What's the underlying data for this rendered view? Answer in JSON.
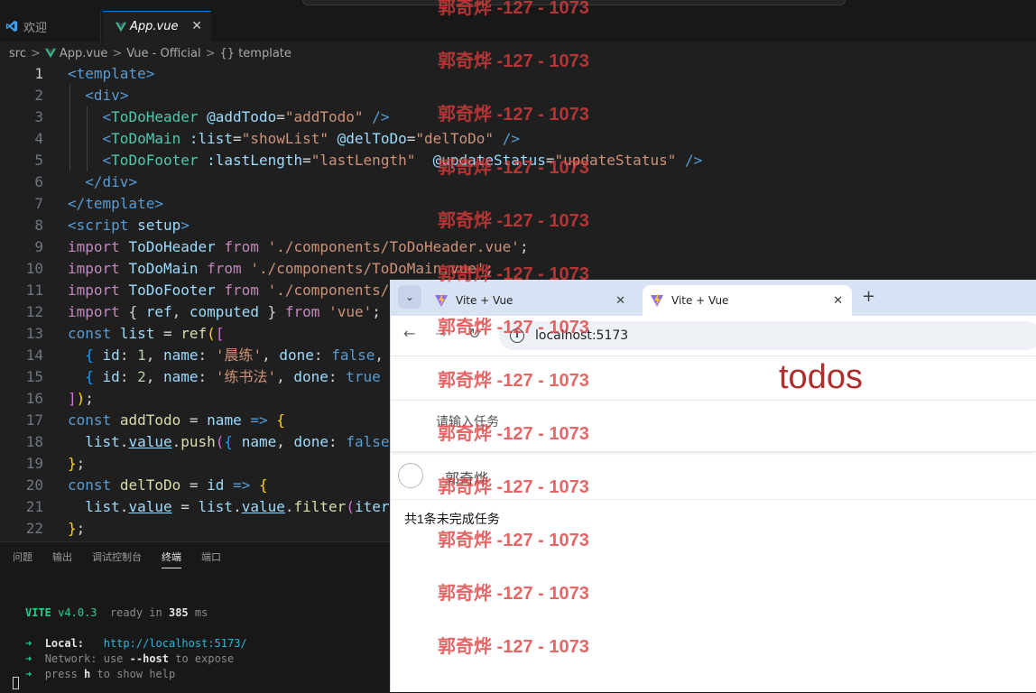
{
  "vscode": {
    "tabs": [
      {
        "label": "欢迎",
        "icon": "vscode-logo-icon"
      },
      {
        "label": "App.vue",
        "icon": "vue-file-icon"
      }
    ],
    "breadcrumb": {
      "src": "src",
      "file": "App.vue",
      "lang": "Vue - Official",
      "symbol": "{} template"
    },
    "code_lines": [
      {
        "n": "1"
      },
      {
        "n": "2"
      },
      {
        "n": "3"
      },
      {
        "n": "4"
      },
      {
        "n": "5"
      },
      {
        "n": "6"
      },
      {
        "n": "7"
      },
      {
        "n": "8"
      },
      {
        "n": "9"
      },
      {
        "n": "10"
      },
      {
        "n": "11"
      },
      {
        "n": "12"
      },
      {
        "n": "13"
      },
      {
        "n": "14"
      },
      {
        "n": "15"
      },
      {
        "n": "16"
      },
      {
        "n": "17"
      },
      {
        "n": "18"
      },
      {
        "n": "19"
      },
      {
        "n": "20"
      },
      {
        "n": "21"
      },
      {
        "n": "22"
      }
    ],
    "code": {
      "l1": [
        "<",
        "template",
        ">"
      ],
      "l2": [
        "<",
        "div",
        ">"
      ],
      "l3": [
        "<",
        "ToDoHeader",
        "@addTodo",
        "=",
        "\"addTodo\"",
        "/>"
      ],
      "l4": [
        "<",
        "ToDoMain",
        ":list",
        "=",
        "\"showList\"",
        "@delToDo",
        "=",
        "\"delToDo\"",
        "/>"
      ],
      "l5": [
        "<",
        "ToDoFooter",
        ":lastLength",
        "=",
        "\"lastLength\"",
        "@updateStatus",
        "=",
        "\"updateStatus\"",
        "/>"
      ],
      "l6": [
        "</",
        "div",
        ">"
      ],
      "l7": [
        "</",
        "template",
        ">"
      ],
      "l8": [
        "<",
        "script",
        "setup",
        ">"
      ],
      "l9": [
        "import",
        "ToDoHeader",
        "from",
        "'./components/ToDoHeader.vue'",
        ";"
      ],
      "l10": [
        "import",
        "ToDoMain",
        "from",
        "'./components/ToDoMain.vue'",
        ";"
      ],
      "l11": [
        "import",
        "ToDoFooter",
        "from",
        "'./components/"
      ],
      "l12": [
        "import",
        "{",
        "ref",
        ",",
        "computed",
        "}",
        "from",
        "'vue'",
        ";"
      ],
      "l13": [
        "const",
        "list",
        "=",
        "ref",
        "(",
        "["
      ],
      "l14": [
        "{",
        "id",
        ":",
        "1",
        ",",
        "name",
        ":",
        "'晨练'",
        ",",
        "done",
        ":",
        "false",
        ","
      ],
      "l15": [
        "{",
        "id",
        ":",
        "2",
        ",",
        "name",
        ":",
        "'练书法'",
        ",",
        "done",
        ":",
        "true"
      ],
      "l16": [
        "]",
        ")",
        ";"
      ],
      "l17": [
        "const",
        "addTodo",
        "=",
        "name",
        "=>",
        "{"
      ],
      "l18": [
        "list",
        ".",
        "value",
        ".",
        "push",
        "(",
        "{",
        "name",
        ",",
        "done",
        ":",
        "false"
      ],
      "l19": [
        "}",
        ";"
      ],
      "l20": [
        "const",
        "delToDo",
        "=",
        "id",
        "=>",
        "{"
      ],
      "l21": [
        "list",
        ".",
        "value",
        "=",
        "list",
        ".",
        "value",
        ".",
        "filter",
        "(",
        "iter"
      ],
      "l22": [
        "}",
        ";"
      ]
    },
    "panel_tabs": [
      "问题",
      "输出",
      "调试控制台",
      "终端",
      "端口"
    ],
    "active_panel_tab": "终端",
    "terminal": {
      "vite": "VITE",
      "version": "v4.0.3",
      "ready": "ready in",
      "ms_value": "385",
      "ms": "ms",
      "local_label": "Local:",
      "local_url": "http://localhost:5173/",
      "network_label": "Network:",
      "network_text_a": "use",
      "network_flag": "--host",
      "network_text_b": "to expose",
      "help_a": "press",
      "help_key": "h",
      "help_b": "to show help"
    }
  },
  "browser": {
    "tabs": [
      {
        "title": "Vite + Vue"
      },
      {
        "title": "Vite + Vue"
      }
    ],
    "url": "localhost:5173",
    "todo": {
      "title": "todos",
      "placeholder": "请输入任务",
      "items": [
        {
          "label": "郭奇烨",
          "done": false
        }
      ],
      "footer": "共1条未完成任务"
    }
  },
  "watermark": "郭奇烨 -127 - 1073",
  "colors": {
    "vscode_bg": "#1f1f1f",
    "todo_title": "#af2f2f",
    "watermark": "#dd3c3c",
    "chrome_tabbar": "#d7e2f4"
  }
}
